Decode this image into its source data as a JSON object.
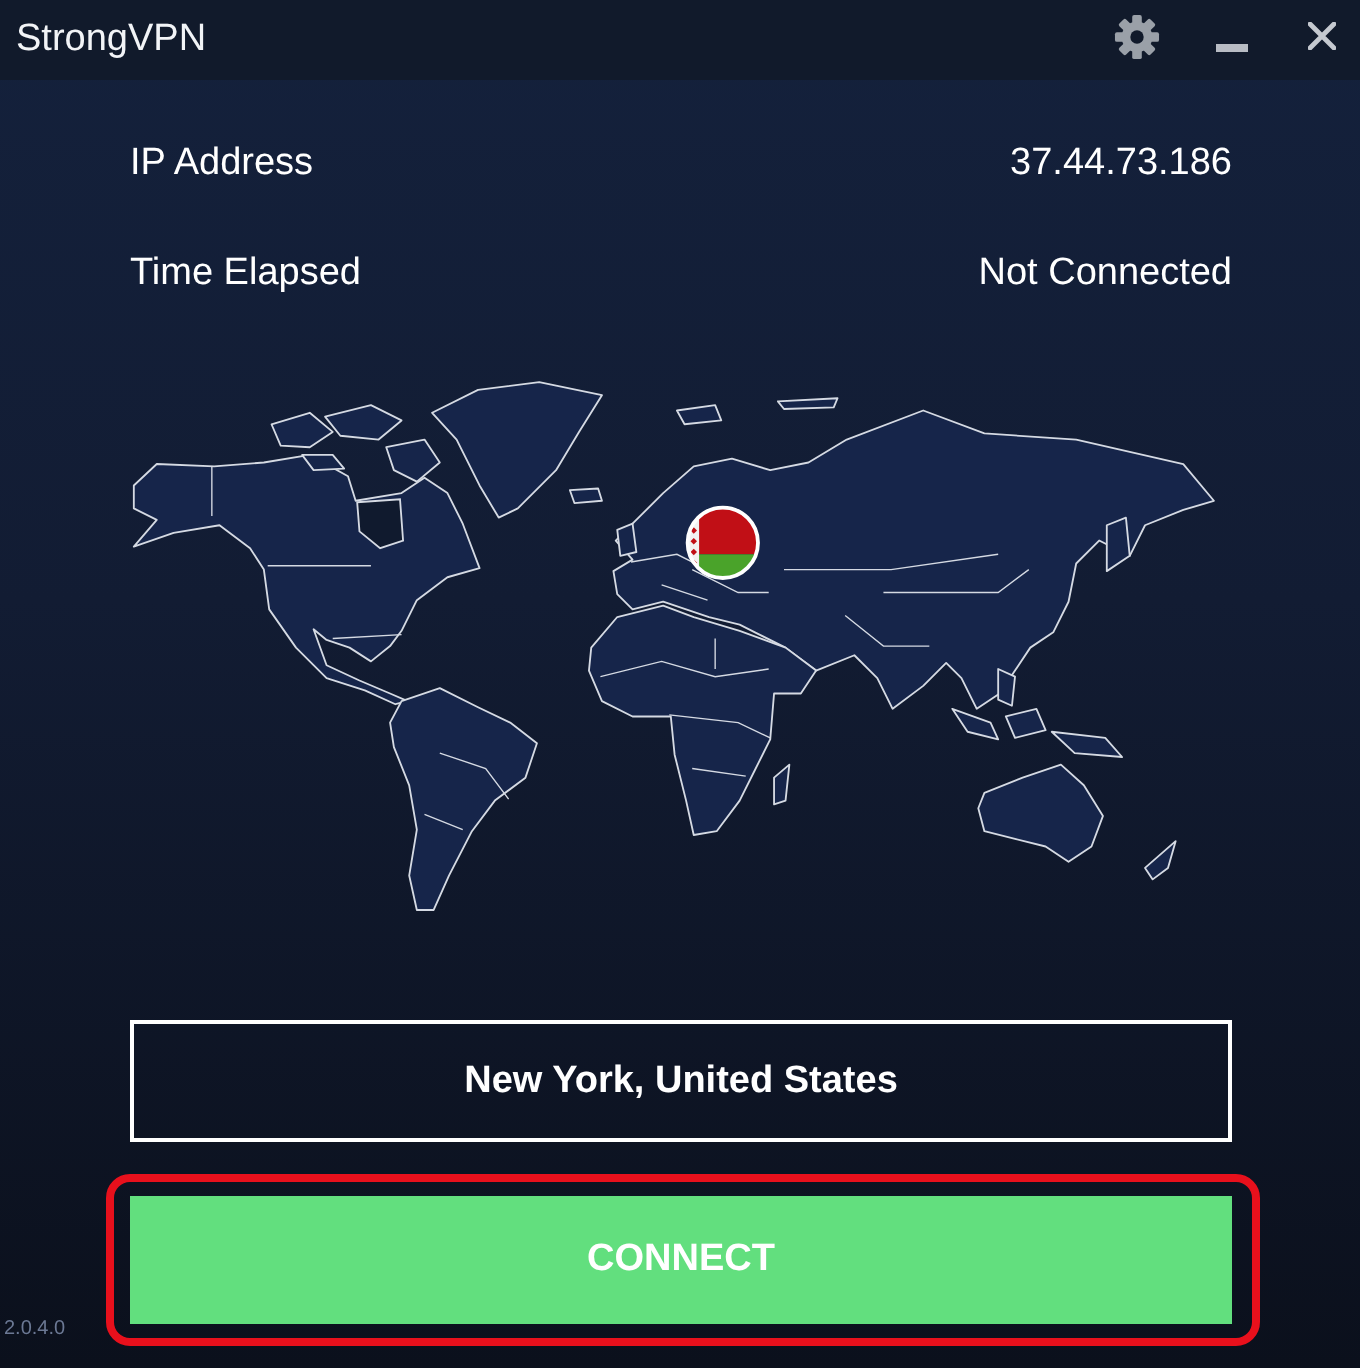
{
  "window": {
    "title": "StrongVPN"
  },
  "info": [
    {
      "label": "IP Address",
      "value": "37.44.73.186"
    },
    {
      "label": "Time Elapsed",
      "value": "Not Connected"
    }
  ],
  "location": {
    "label": "New York, United States"
  },
  "connect_button": {
    "label": "CONNECT",
    "highlighted": true
  },
  "version": "2.0.4.0"
}
